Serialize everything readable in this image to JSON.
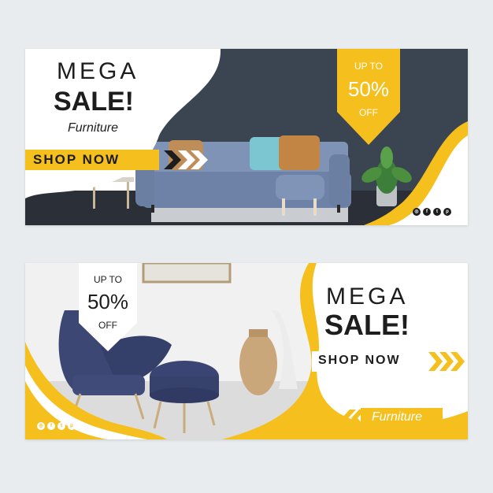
{
  "colors": {
    "accent": "#f5bf1d",
    "dark": "#1d1d1d",
    "wall": "#3b4451",
    "sofa": "#7e93b6"
  },
  "banner_top": {
    "headline": "MEGA",
    "headline2": "SALE!",
    "category": "Furniture",
    "cta": "SHOP NOW",
    "discount": {
      "prefix": "UP TO",
      "value": "50%",
      "suffix": "OFF"
    },
    "social_icons": [
      "instagram-icon",
      "facebook-icon",
      "twitter-icon",
      "pinterest-icon"
    ]
  },
  "banner_bottom": {
    "headline": "MEGA",
    "headline2": "SALE!",
    "category": "Furniture",
    "cta": "SHOP NOW",
    "discount": {
      "prefix": "UP TO",
      "value": "50%",
      "suffix": "OFF"
    },
    "social_icons": [
      "instagram-icon",
      "facebook-icon",
      "twitter-icon",
      "pinterest-icon"
    ]
  }
}
